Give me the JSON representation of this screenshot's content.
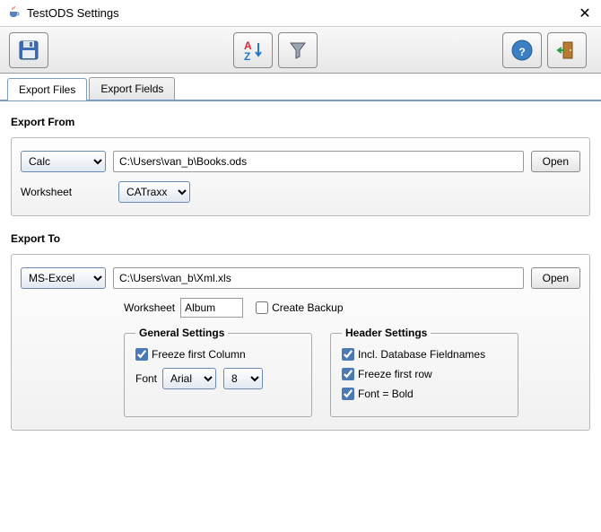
{
  "window": {
    "title": "TestODS Settings"
  },
  "toolbar": {
    "save": "save",
    "sort": "sort",
    "filter": "filter",
    "help": "help",
    "exit": "exit"
  },
  "tabs": {
    "export_files": "Export Files",
    "export_fields": "Export Fields"
  },
  "export_from": {
    "title": "Export From",
    "format": "Calc",
    "format_options": [
      "Calc"
    ],
    "path": "C:\\Users\\van_b\\Books.ods",
    "open": "Open",
    "worksheet_label": "Worksheet",
    "worksheet": "CATraxx",
    "worksheet_options": [
      "CATraxx"
    ]
  },
  "export_to": {
    "title": "Export To",
    "format": "MS-Excel",
    "format_options": [
      "MS-Excel"
    ],
    "path": "C:\\Users\\van_b\\Xml.xls",
    "open": "Open",
    "worksheet_label": "Worksheet",
    "worksheet": "Album",
    "create_backup_label": "Create Backup",
    "create_backup": false,
    "general": {
      "title": "General Settings",
      "freeze_col_label": "Freeze first Column",
      "freeze_col": true,
      "font_label": "Font",
      "font": "Arial",
      "font_options": [
        "Arial"
      ],
      "size": "8",
      "size_options": [
        "8"
      ]
    },
    "header": {
      "title": "Header Settings",
      "incl_db_label": "Incl. Database Fieldnames",
      "incl_db": true,
      "freeze_row_label": "Freeze first row",
      "freeze_row": true,
      "bold_label": "Font = Bold",
      "bold": true
    }
  }
}
